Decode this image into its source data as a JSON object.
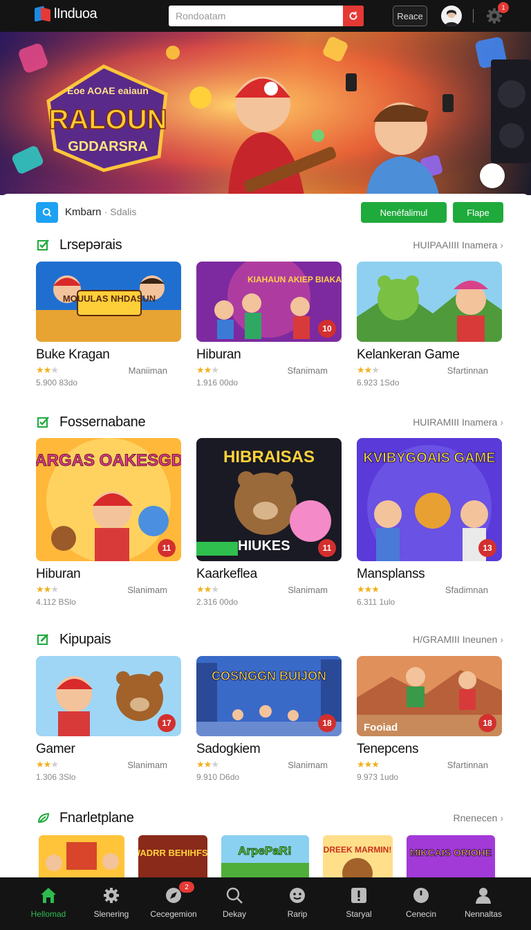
{
  "app": {
    "logo_text": "lInduoa"
  },
  "header": {
    "search_placeholder": "Rondoatam",
    "place_label": "Reace",
    "notification_count": "1"
  },
  "filter": {
    "label": "Kmbarn",
    "sub_label": "· Sdalis",
    "button_primary": "Nenéfalimul",
    "button_secondary": "Flape"
  },
  "sections": [
    {
      "title": "Lrsepərais",
      "more": "HUIPAAIIII Inamera",
      "icon": "check-square-icon",
      "cards": [
        {
          "title": "Buke Kragan",
          "stars": 2,
          "tag": "Maniiman",
          "views": "5.900 83do",
          "badge": "",
          "thumb_text": "MOUULAS NHDASUN"
        },
        {
          "title": "Hiburan",
          "stars": 2,
          "tag": "Sfanimam",
          "views": "1.916 00do",
          "badge": "10",
          "thumb_text": "KIAHAUN AKIEP BIAKAES"
        },
        {
          "title": "Kelankeran Game",
          "stars": 2,
          "tag": "Sfartinnan",
          "views": "6.923 1Sdo",
          "badge": "",
          "thumb_text": ""
        }
      ]
    },
    {
      "title": "Fossernabane",
      "more": "HUIRAMIII Inamera",
      "icon": "check-square-icon",
      "cards": [
        {
          "title": "Hiburan",
          "stars": 2,
          "tag": "Slanimam",
          "views": "4.112 BSlo",
          "badge": "11",
          "thumb_text": "CHARGAS OAKESGDAS"
        },
        {
          "title": "Kaarkeflea",
          "stars": 2,
          "tag": "Slanimam",
          "views": "2.316 00do",
          "badge": "11",
          "thumb_text": "HIBRAISAS",
          "thumb_caption": "HIUKES"
        },
        {
          "title": "Mansplanss",
          "stars": 3,
          "tag": "Sfadimnan",
          "views": "6.311 1ulo",
          "badge": "13",
          "thumb_text": "KVIBYGOAIS GAME"
        }
      ]
    },
    {
      "title": "Kipupais",
      "more": "H/GRAMIII Ineunen",
      "icon": "edit-square-icon",
      "cards": [
        {
          "title": "Gamer",
          "stars": 2,
          "tag": "Slanimam",
          "views": "1.306 3Slo",
          "badge": "17",
          "thumb_text": ""
        },
        {
          "title": "Sadogkiem",
          "stars": 2,
          "tag": "Slanimam",
          "views": "9.910 D6do",
          "badge": "18",
          "thumb_text": "COSNGGN BUIJON"
        },
        {
          "title": "Tenepcens",
          "stars": 3,
          "tag": "Sfartinnan",
          "views": "9.973 1udo",
          "badge": "18",
          "thumb_text": "",
          "thumb_caption": "Fooiad"
        }
      ]
    },
    {
      "title": "Fnarletplane",
      "more": "Rnenecen",
      "icon": "leaf-icon",
      "strip": [
        "",
        "WADRR BEHIHFSS",
        "ArpePaR!",
        "DREEK MARMIN!",
        "MIKCAIS ORIOHE"
      ]
    }
  ],
  "bottom_nav": [
    {
      "label": "Hellomad",
      "icon": "home-icon",
      "active": true
    },
    {
      "label": "Slenering",
      "icon": "gear-icon",
      "active": false
    },
    {
      "label": "Cecegemion",
      "icon": "compass-icon",
      "active": false,
      "badge": "2"
    },
    {
      "label": "Dekay",
      "icon": "search-icon",
      "active": false
    },
    {
      "label": "Rarip",
      "icon": "face-icon",
      "active": false
    },
    {
      "label": "Staryal",
      "icon": "alert-box-icon",
      "active": false
    },
    {
      "label": "Cenecin",
      "icon": "clock-icon",
      "active": false
    },
    {
      "label": "Nennaltas",
      "icon": "user-icon",
      "active": false
    }
  ],
  "colors": {
    "accent": "#1faa3c",
    "header_bg": "#141414",
    "badge": "#d32f2f",
    "star": "#f2b01e"
  }
}
